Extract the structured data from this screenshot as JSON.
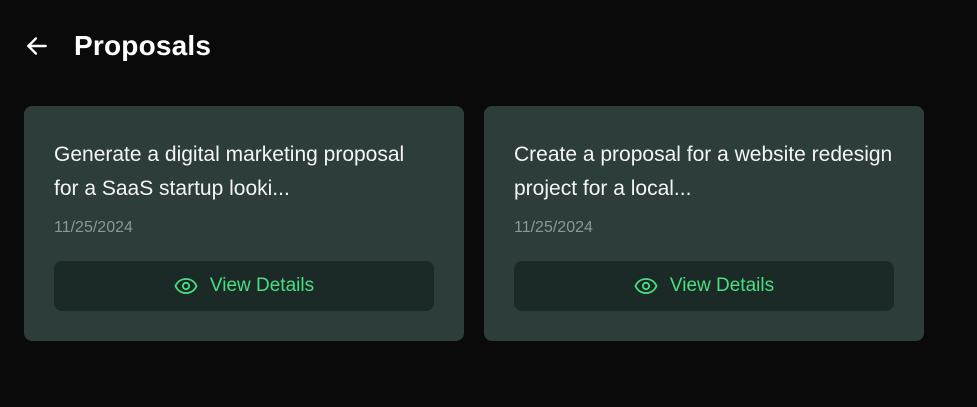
{
  "header": {
    "back_icon": "arrow-left-icon",
    "title": "Proposals"
  },
  "proposals": [
    {
      "title": "Generate a digital marketing proposal for a SaaS startup looki...",
      "date": "11/25/2024",
      "action_label": "View Details",
      "action_icon": "eye-icon"
    },
    {
      "title": "Create a proposal for a website redesign project for a local...",
      "date": "11/25/2024",
      "action_label": "View Details",
      "action_icon": "eye-icon"
    }
  ],
  "colors": {
    "background": "#0a0a0a",
    "card": "#2d3d3a",
    "button": "#1c2a27",
    "accent": "#4ade80",
    "muted_text": "#8b9794"
  }
}
